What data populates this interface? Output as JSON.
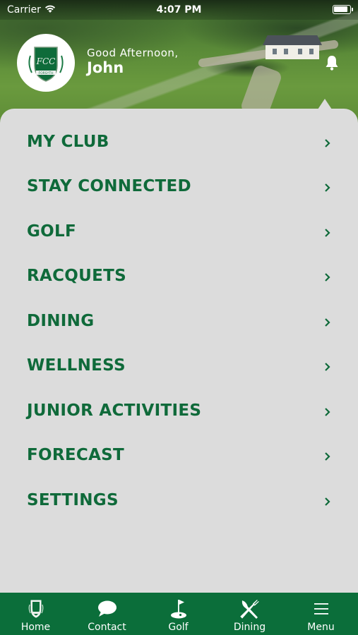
{
  "status_bar": {
    "carrier": "Carrier",
    "time": "4:07 PM"
  },
  "header": {
    "greeting": "Good Afternoon,",
    "user_name": "John",
    "logo_icon": "club-crest-icon",
    "logo_text": "FCC",
    "logo_subtext": "FORSYTH",
    "notification_icon": "bell-icon"
  },
  "menu": {
    "items": [
      {
        "label": "MY CLUB"
      },
      {
        "label": "STAY CONNECTED"
      },
      {
        "label": "GOLF"
      },
      {
        "label": "RACQUETS"
      },
      {
        "label": "DINING"
      },
      {
        "label": "WELLNESS"
      },
      {
        "label": "JUNIOR ACTIVITIES"
      },
      {
        "label": "FORECAST"
      },
      {
        "label": "SETTINGS"
      }
    ],
    "chevron_icon": "chevron-right-icon"
  },
  "tab_bar": {
    "tabs": [
      {
        "label": "Home",
        "icon": "club-crest-icon"
      },
      {
        "label": "Contact",
        "icon": "chat-bubble-icon"
      },
      {
        "label": "Golf",
        "icon": "golf-flag-icon"
      },
      {
        "label": "Dining",
        "icon": "fork-knife-icon"
      },
      {
        "label": "Menu",
        "icon": "hamburger-menu-icon"
      }
    ]
  },
  "colors": {
    "brand_green": "#0b6e3a",
    "menu_text": "#0f6a3a",
    "panel_bg": "#dcdcdc"
  }
}
